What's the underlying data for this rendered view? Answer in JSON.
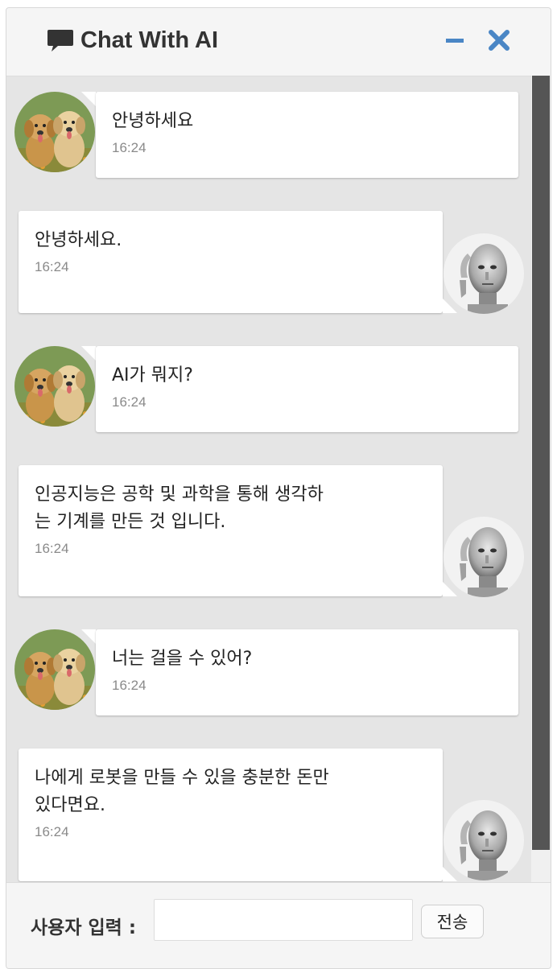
{
  "header": {
    "title": "Chat With AI",
    "chat_icon": "chat-bubble-icon",
    "minimize_icon": "minus-icon",
    "close_icon": "close-icon",
    "accent_color": "#4a86c5"
  },
  "messages": [
    {
      "sender": "user",
      "avatar": "puppies-avatar",
      "text": "안녕하세요",
      "time": "16:24"
    },
    {
      "sender": "ai",
      "avatar": "robot-avatar",
      "text": "안녕하세요.",
      "time": "16:24"
    },
    {
      "sender": "user",
      "avatar": "puppies-avatar",
      "text": "AI가 뭐지?",
      "time": "16:24"
    },
    {
      "sender": "ai",
      "avatar": "robot-avatar",
      "text": "인공지능은 공학 및 과학을 통해 생각하\n는 기계를 만든 것 입니다.",
      "time": "16:24"
    },
    {
      "sender": "user",
      "avatar": "puppies-avatar",
      "text": "너는 걸을 수 있어?",
      "time": "16:24"
    },
    {
      "sender": "ai",
      "avatar": "robot-avatar",
      "text": "나에게 로봇을 만들 수 있을 충분한 돈만\n있다면요.",
      "time": "16:24"
    }
  ],
  "footer": {
    "input_label": "사용자 입력 :",
    "input_value": "",
    "send_label": "전송"
  }
}
